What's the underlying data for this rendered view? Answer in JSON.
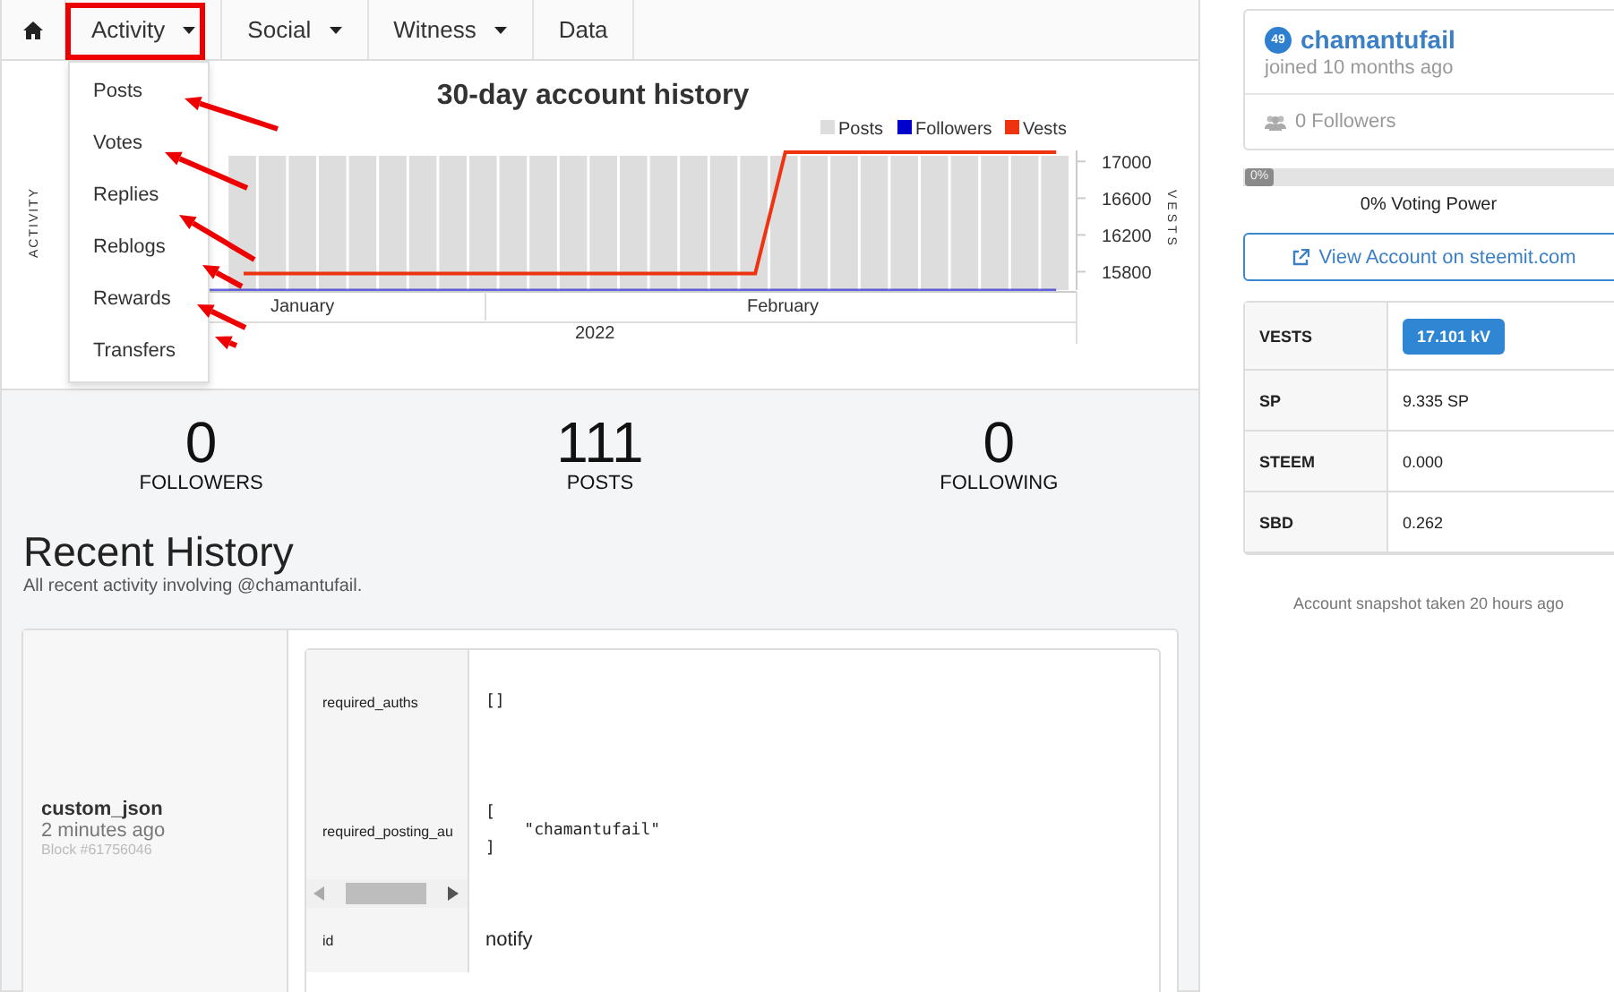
{
  "nav": {
    "tabs": [
      {
        "kind": "home"
      },
      {
        "kind": "dropdown",
        "label": "Activity"
      },
      {
        "kind": "dropdown",
        "label": "Social"
      },
      {
        "kind": "dropdown",
        "label": "Witness"
      },
      {
        "kind": "link",
        "label": "Data"
      }
    ],
    "menu": [
      "Posts",
      "Votes",
      "Replies",
      "Reblogs",
      "Rewards",
      "Transfers"
    ]
  },
  "chart": {
    "left_axis": "ACTIVITY",
    "months": [
      "January",
      "February"
    ],
    "year": "2022",
    "legend": [
      {
        "name": "Posts",
        "color": "#dddddd"
      },
      {
        "name": "Followers",
        "color": "#0000cc"
      }
    ],
    "chart_data": {
      "type": "line",
      "title": "30-day account history",
      "ylabel": "VESTS",
      "yticks": [
        15800,
        16200,
        16600,
        17000
      ],
      "ylim": [
        15600,
        17120
      ],
      "series": [
        {
          "name": "Vests",
          "color": "#ee3311",
          "values": [
            null,
            null,
            15780,
            15780,
            15780,
            15780,
            15780,
            15780,
            15780,
            15780,
            15780,
            15780,
            15780,
            15780,
            15780,
            15780,
            15780,
            15780,
            15780,
            15780,
            17100,
            17100,
            17100,
            17100,
            17100,
            17100,
            17100,
            17100,
            17100,
            17100
          ]
        }
      ]
    }
  },
  "stats": [
    {
      "value": "0",
      "label": "FOLLOWERS"
    },
    {
      "value": "111",
      "label": "POSTS"
    },
    {
      "value": "0",
      "label": "FOLLOWING"
    }
  ],
  "history": {
    "title": "Recent History",
    "subtitle": "All recent activity involving @chamantufail.",
    "entries": [
      {
        "type": "custom_json",
        "time": "2 minutes ago",
        "block": "Block #61756046",
        "fields": [
          {
            "key": "required_auths",
            "value": "[]"
          },
          {
            "key": "required_posting_au",
            "value": "[\n    \"chamantufail\"\n]",
            "scroll": true
          },
          {
            "key": "id",
            "value": "notify"
          }
        ]
      }
    ]
  },
  "profile": {
    "reputation": "49",
    "name": "chamantufail",
    "joined": "joined 10 months ago",
    "followers": "0 Followers"
  },
  "voting": {
    "badge": "0%",
    "level": 0,
    "label": "0% Voting Power"
  },
  "view_button": "View Account on steemit.com",
  "balances": [
    {
      "label": "VESTS",
      "value": "17.101 kV",
      "badge": true
    },
    {
      "label": "SP",
      "value": "9.335 SP",
      "badge": false
    },
    {
      "label": "STEEM",
      "value": "0.000",
      "badge": false
    },
    {
      "label": "SBD",
      "value": "0.262",
      "badge": false
    }
  ],
  "snapshot": "Account snapshot taken 20 hours ago"
}
